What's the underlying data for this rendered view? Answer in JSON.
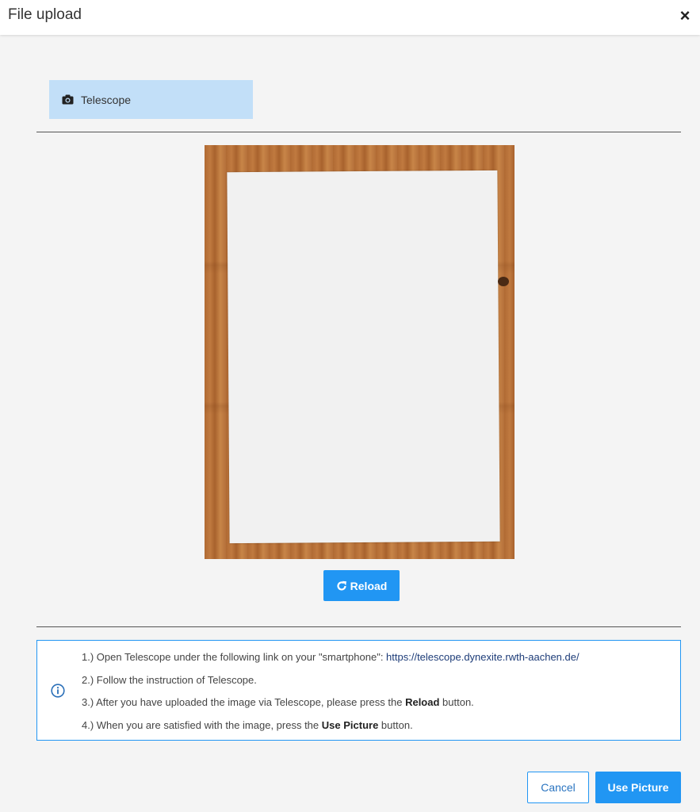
{
  "dialog": {
    "title": "File upload",
    "close_label": "×"
  },
  "source_tab": {
    "label": "Telescope",
    "icon": "camera-icon"
  },
  "preview": {
    "description_icon": "photo-preview"
  },
  "reload_button": {
    "label": "Reload",
    "icon": "reload-icon"
  },
  "instructions": {
    "icon": "info-icon",
    "steps": [
      {
        "prefix": "1.) Open Telescope under the following link on your \"smartphone\": ",
        "link": "https://telescope.dynexite.rwth-aachen.de/"
      },
      {
        "text": "2.) Follow the instruction of Telescope."
      },
      {
        "prefix": "3.) After you have uploaded the image via Telescope, please press the ",
        "bold": "Reload",
        "suffix": " button."
      },
      {
        "prefix": "4.) When you are satisfied with the image, press the ",
        "bold": "Use Picture",
        "suffix": " button."
      }
    ]
  },
  "footer": {
    "cancel_label": "Cancel",
    "use_label": "Use Picture"
  },
  "colors": {
    "accent": "#2196f3",
    "tab_bg": "#c2dff8",
    "page_bg": "#f4f4f4"
  }
}
